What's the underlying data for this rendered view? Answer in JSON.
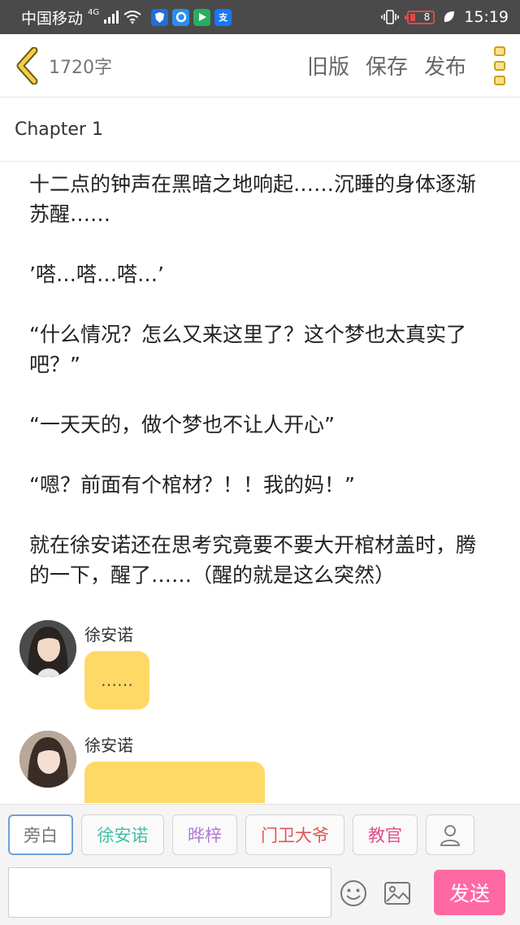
{
  "status_bar": {
    "carrier": "中国移动",
    "network": "4G",
    "battery": "8",
    "time": "15:19",
    "app_icons": [
      "shield-app-icon",
      "browser-app-icon",
      "video-app-icon",
      "alipay-app-icon"
    ]
  },
  "header": {
    "word_count": "1720字",
    "actions": [
      "旧版",
      "保存",
      "发布"
    ],
    "icons": {
      "back": "chevron-left-icon",
      "menu": "more-menu-icon"
    },
    "accent": "#c9a21e"
  },
  "chapter": {
    "title": "Chapter 1"
  },
  "narration": [
    "十二点的钟声在黑暗之地响起……沉睡的身体逐渐苏醒……",
    "’嗒…嗒…嗒…’",
    "“什么情况？怎么又来这里了？这个梦也太真实了吧？”",
    "“一天天的，做个梦也不让人开心”",
    "“嗯？前面有个棺材？！！我的妈！”",
    "就在徐安诺还在思考究竟要不要大开棺材盖时，腾的一下，醒了……（醒的就是这么突然）"
  ],
  "messages": [
    {
      "speaker": "徐安诺",
      "text": "……"
    },
    {
      "speaker": "徐安诺",
      "text": ""
    }
  ],
  "characters": [
    {
      "name": "旁白",
      "color": "#777777",
      "active": true
    },
    {
      "name": "徐安诺",
      "color": "#3fbfa8",
      "active": false
    },
    {
      "name": "晔梓",
      "color": "#b07ad6",
      "active": false
    },
    {
      "name": "门卫大爷",
      "color": "#e05555",
      "active": false
    },
    {
      "name": "教官",
      "color": "#e0508c",
      "active": false
    }
  ],
  "composer": {
    "input_value": "",
    "send_label": "发送",
    "send_color": "#ff69a3",
    "icons": [
      "emoji-icon",
      "image-icon"
    ]
  }
}
